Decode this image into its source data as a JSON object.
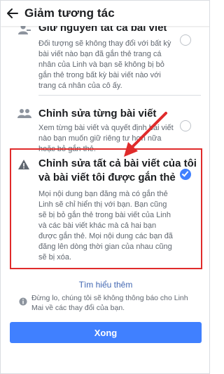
{
  "header": {
    "title": "Giảm tương tác",
    "back_icon": "back-arrow-icon"
  },
  "options": [
    {
      "title": "Giữ nguyên tất cả bài viết",
      "description": "Đối tượng sẽ không thay đổi với bất kỳ bài viết nào bạn đã gắn thẻ trang cá nhân của Linh và bạn sẽ không bị bỏ gắn thẻ trong bất kỳ bài viết nào với trang cá nhân của cô ấy.",
      "icon": "person-icon",
      "selected": false
    },
    {
      "title": "Chỉnh sửa từng bài viết",
      "description": "Xem từng bài viết và quyết định bài viết nào bạn muốn giữ riêng tư hơn nữa hoặc bỏ gắn thẻ.",
      "icon": "people-icon",
      "selected": false
    },
    {
      "title_line1": "Chỉnh sửa tất cả bài viết của tôi",
      "title_line2": "và bài viết tôi được gắn thẻ",
      "description": "Mọi nội dung bạn đăng mà có gắn thẻ Linh sẽ chỉ hiển thị với bạn. Bạn cũng sẽ bị bỏ gắn thẻ trong bài viết của Linh và các bài viết khác mà cả hai bạn được gắn thẻ. Mọi nội dung các bạn đã đăng lên dòng thời gian của nhau cũng sẽ bị xóa.",
      "icon": "warning-icon",
      "selected": true
    }
  ],
  "learn_more": "Tìm hiểu thêm",
  "notice": "Đừng lo, chúng tôi sẽ không thông báo cho Linh Mai về các thay đổi của bạn.",
  "done_button": "Xong",
  "colors": {
    "accent": "#4080ff",
    "highlight": "#e02b2b",
    "link": "#4267b2"
  }
}
